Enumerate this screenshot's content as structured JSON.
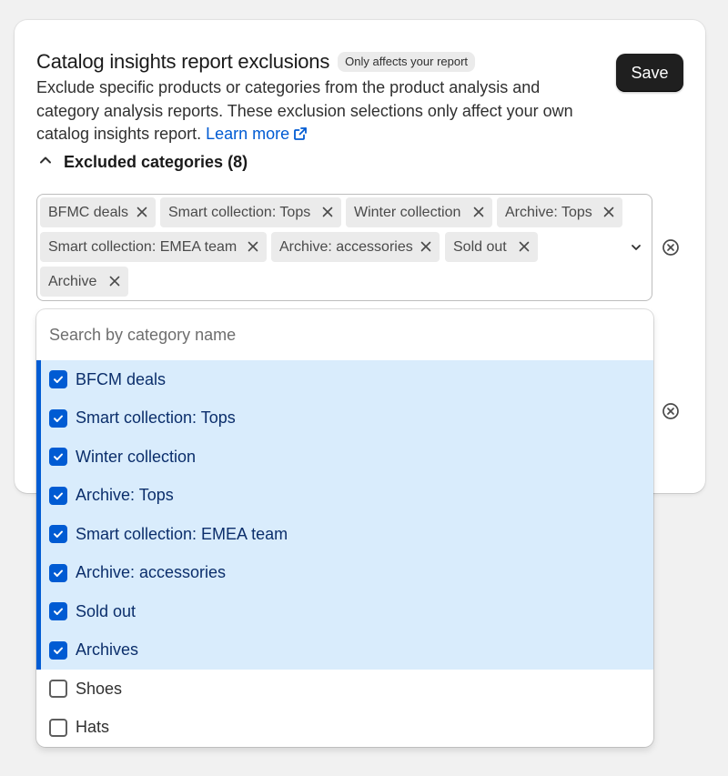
{
  "header": {
    "title": "Catalog insights report exclusions",
    "badge": "Only affects your report",
    "save_label": "Save",
    "description": "Exclude specific products or categories from the product analysis and category analysis reports. These exclusion selections only affect your own catalog insights report.",
    "learn_more": "Learn more"
  },
  "excluded": {
    "label": "Excluded categories (8)"
  },
  "tags": [
    "BFMC deals",
    "Smart collection: Tops",
    "Winter collection",
    "Archive: Tops",
    "Smart collection: EMEA team",
    "Archive: accessories",
    "Sold out",
    "Archive"
  ],
  "search": {
    "placeholder": "Search by category name",
    "value": ""
  },
  "options": [
    {
      "label": "BFCM deals",
      "checked": true
    },
    {
      "label": "Smart collection: Tops",
      "checked": true
    },
    {
      "label": "Winter collection",
      "checked": true
    },
    {
      "label": "Archive: Tops",
      "checked": true
    },
    {
      "label": "Smart collection: EMEA team",
      "checked": true
    },
    {
      "label": "Archive: accessories",
      "checked": true
    },
    {
      "label": "Sold out",
      "checked": true
    },
    {
      "label": "Archives",
      "checked": true
    },
    {
      "label": "Shoes",
      "checked": false
    },
    {
      "label": "Hats",
      "checked": false
    }
  ],
  "colors": {
    "accent": "#005bd3",
    "selected_bg": "#d9ecfc",
    "button": "#1f1f1f"
  },
  "icons": {
    "collapse": "chevron-up-icon",
    "dropdown": "chevron-down-icon",
    "remove_tag": "x-icon",
    "clear": "x-circle-icon",
    "external": "external-link-icon"
  }
}
